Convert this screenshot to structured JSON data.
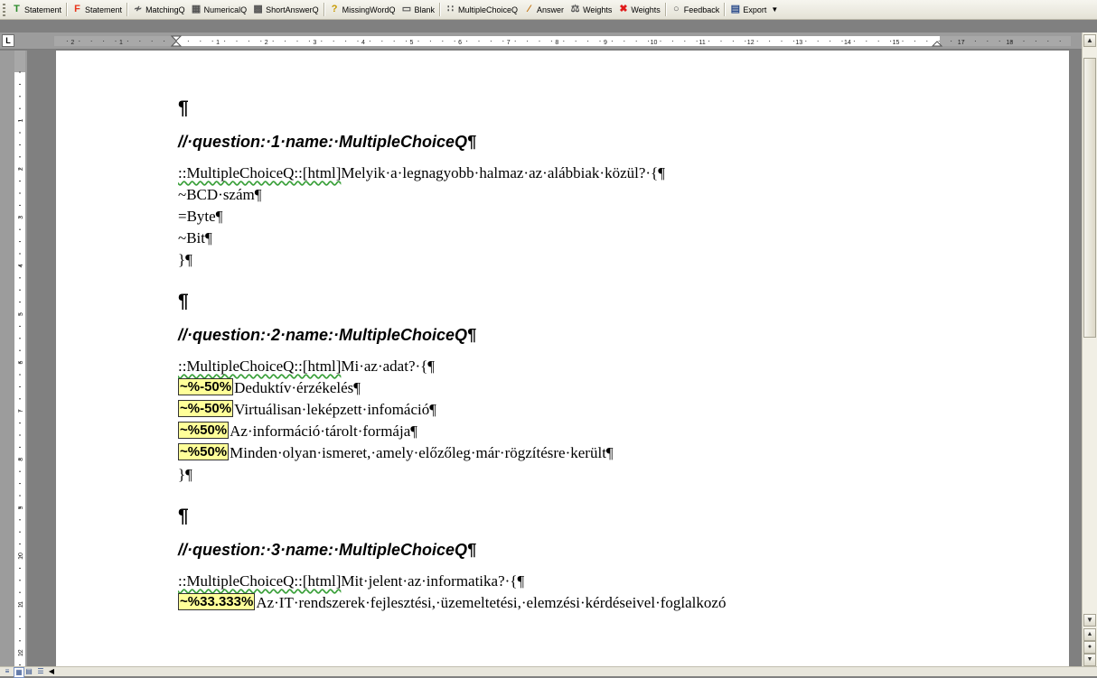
{
  "toolbar": {
    "buttons": [
      {
        "label": "Statement",
        "icon": "T",
        "icon_color": "#2a8a2a"
      },
      {
        "label": "Statement",
        "icon": "F",
        "icon_color": "#e8351b"
      },
      {
        "label": "MatchingQ",
        "icon": "≁",
        "icon_color": "#555555"
      },
      {
        "label": "NumericalQ",
        "icon": "▦",
        "icon_color": "#555555"
      },
      {
        "label": "ShortAnswerQ",
        "icon": "▩",
        "icon_color": "#555555"
      },
      {
        "label": "MissingWordQ",
        "icon": "?",
        "icon_color": "#c79a00"
      },
      {
        "label": "Blank",
        "icon": "▭",
        "icon_color": "#555555"
      },
      {
        "label": "MultipleChoiceQ",
        "icon": "∷",
        "icon_color": "#555555"
      },
      {
        "label": "Answer",
        "icon": "⁄",
        "icon_color": "#c06a00"
      },
      {
        "label": "Weights",
        "icon": "⚖",
        "icon_color": "#555555"
      },
      {
        "label": "Weights",
        "icon": "✖",
        "icon_color": "#e01b1b"
      },
      {
        "label": "Feedback",
        "icon": "○",
        "icon_color": "#555555"
      },
      {
        "label": "Export",
        "icon": "▤",
        "icon_color": "#2c4c8c"
      }
    ]
  },
  "ruler": {
    "corner_label": "L",
    "h_labels": [
      "2",
      "1",
      "1",
      "2",
      "3",
      "4",
      "5",
      "6",
      "7",
      "8",
      "9",
      "10",
      "11",
      "12",
      "13",
      "14",
      "15",
      "17",
      "18"
    ],
    "v_labels": [
      "1",
      "2",
      "3",
      "4",
      "5",
      "6",
      "7",
      "8",
      "9",
      "10",
      "11",
      "12"
    ]
  },
  "document": {
    "pilcrow": "¶",
    "questions": [
      {
        "heading": "//·question:·1·name:·MultipleChoiceQ¶",
        "stem_prefix": "::MultipleChoiceQ::[html]",
        "stem_text": "Melyik·a·legnagyobb·halmaz·az·alábbiak·közül?·{¶",
        "answers": [
          {
            "weight": "",
            "text": "~BCD·szám¶"
          },
          {
            "weight": "",
            "text": "=Byte¶"
          },
          {
            "weight": "",
            "text": "~Bit¶"
          }
        ],
        "close": "}¶"
      },
      {
        "heading": "//·question:·2·name:·MultipleChoiceQ¶",
        "stem_prefix": "::MultipleChoiceQ::[html]",
        "stem_text": "Mi·az·adat?·{¶",
        "answers": [
          {
            "weight": "~%-50%",
            "text": "Deduktív·érzékelés¶"
          },
          {
            "weight": "~%-50%",
            "text": "Virtuálisan·leképzett·infomáció¶"
          },
          {
            "weight": "~%50%",
            "text": "Az·információ·tárolt·formája¶"
          },
          {
            "weight": "~%50%",
            "text": "Minden·olyan·ismeret,·amely·előzőleg·már·rögzítésre·került¶"
          }
        ],
        "close": "}¶"
      },
      {
        "heading": "//·question:·3·name:·MultipleChoiceQ¶",
        "stem_prefix": "::MultipleChoiceQ::[html]",
        "stem_text": "Mit·jelent·az·informatika?·{¶",
        "answers": [
          {
            "weight": "~%33.333%",
            "text": "Az·IT·rendszerek·fejlesztési,·üzemeltetési,·elemzési·kérdéseivel·foglalkozó"
          }
        ],
        "close": ""
      }
    ]
  },
  "colors": {
    "weight_bg": "#ffff99",
    "squiggle_red": "#e23a3a",
    "squiggle_green": "#3aa03a"
  }
}
